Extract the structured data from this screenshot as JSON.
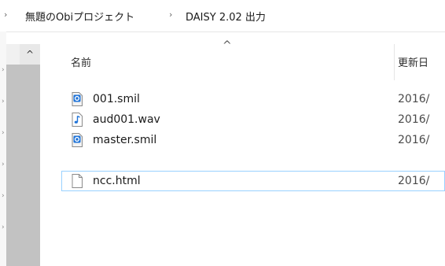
{
  "breadcrumb": {
    "items": [
      "無題のObiプロジェクト",
      "DAISY 2.02 出力"
    ]
  },
  "columns": {
    "name": "名前",
    "date": "更新日"
  },
  "files": [
    {
      "name": "001.smil",
      "date": "2016/",
      "icon": "smil-file-icon"
    },
    {
      "name": "aud001.wav",
      "date": "2016/",
      "icon": "audio-file-icon"
    },
    {
      "name": "master.smil",
      "date": "2016/",
      "icon": "smil-file-icon"
    },
    {
      "name": "ncc.html",
      "date": "2016/",
      "icon": "blank-document-icon",
      "selected": true
    }
  ],
  "colors": {
    "selection_border": "#99d1ff",
    "scroll_thumb": "#c2c2c2",
    "icon_blue": "#1e73d8"
  }
}
